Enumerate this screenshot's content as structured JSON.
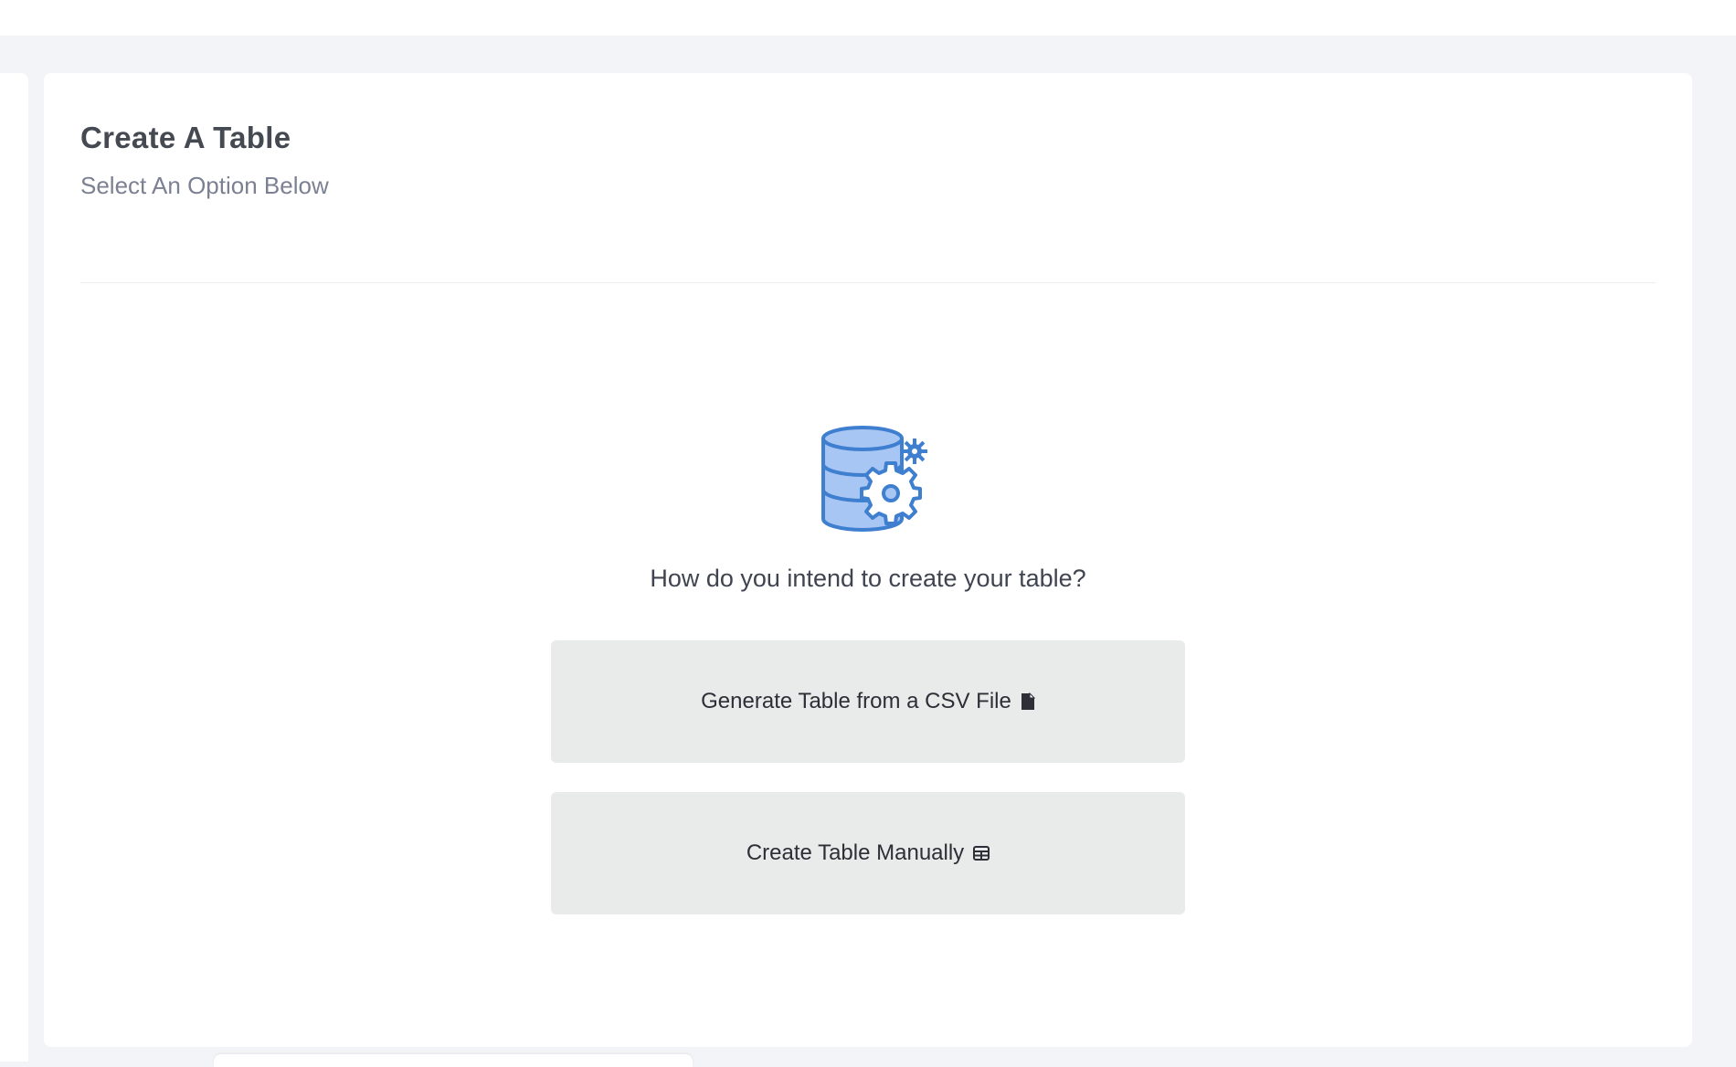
{
  "header": {
    "title": "Create A Table",
    "subtitle": "Select An Option Below"
  },
  "main": {
    "icon": "database-gear-icon",
    "prompt": "How do you intend to create your table?",
    "options": [
      {
        "label": "Generate Table from a CSV File",
        "icon": "file-icon"
      },
      {
        "label": "Create Table Manually",
        "icon": "table-icon"
      }
    ]
  },
  "colors": {
    "accent": "#3f7fd0",
    "accent_fill": "#a7c6f3",
    "button_bg": "#e9eaea",
    "page_bg": "#f3f4f7"
  }
}
